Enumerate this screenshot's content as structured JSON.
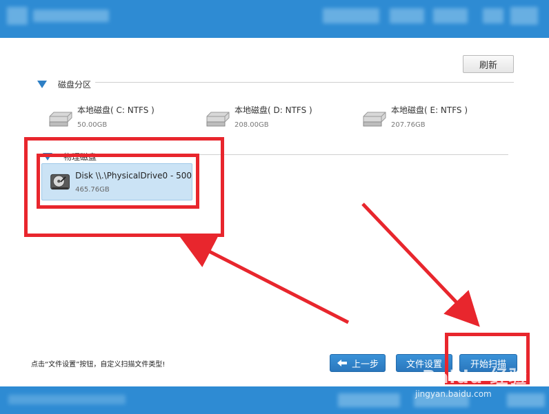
{
  "toolbar": {
    "refresh_label": "刷新"
  },
  "sections": {
    "partitions_title": "磁盘分区",
    "physical_title": "物理磁盘"
  },
  "partitions": [
    {
      "name": "本地磁盘( C: NTFS )",
      "size": "50.00GB"
    },
    {
      "name": "本地磁盘( D: NTFS )",
      "size": "208.00GB"
    },
    {
      "name": "本地磁盘( E: NTFS )",
      "size": "207.76GB"
    }
  ],
  "physical_disk": {
    "name": "Disk \\\\.\\PhysicalDrive0 - 500",
    "size": "465.76GB"
  },
  "footer": {
    "hint": "点击“文件设置”按钮，自定义扫描文件类型!",
    "back_label": "上一步",
    "file_settings_label": "文件设置",
    "start_scan_label": "开始扫描"
  },
  "watermark": {
    "brand": "Baidu 经验",
    "url": "jingyan.baidu.com"
  },
  "colors": {
    "titlebar": "#2e8bd3",
    "button": "#2a77bd",
    "selection": "#cbe3f5",
    "annotation": "#e8262d"
  },
  "icons": [
    "disk-icon",
    "hdd-icon",
    "back-arrow-icon"
  ]
}
